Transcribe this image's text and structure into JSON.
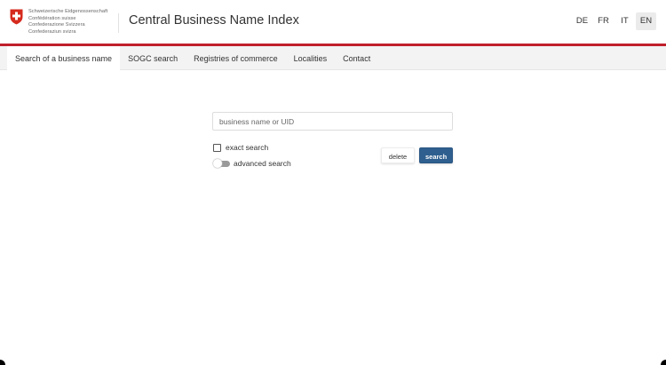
{
  "header": {
    "logo_lines": [
      "Schweizerische Eidgenossenschaft",
      "Confédération suisse",
      "Confederazione Svizzera",
      "Confederaziun svizra"
    ],
    "logo_icon": "swiss-cross-shield-icon",
    "title": "Central Business Name Index",
    "languages": [
      {
        "code": "DE",
        "active": false
      },
      {
        "code": "FR",
        "active": false
      },
      {
        "code": "IT",
        "active": false
      },
      {
        "code": "EN",
        "active": true
      }
    ]
  },
  "nav": {
    "items": [
      {
        "label": "Search of a business name",
        "active": true
      },
      {
        "label": "SOGC search",
        "active": false
      },
      {
        "label": "Registries of commerce",
        "active": false
      },
      {
        "label": "Localities",
        "active": false
      },
      {
        "label": "Contact",
        "active": false
      }
    ]
  },
  "search": {
    "input_value": "",
    "placeholder": "business name or UID",
    "exact_search_label": "exact search",
    "exact_search_checked": false,
    "advanced_search_label": "advanced search",
    "advanced_search_on": false,
    "delete_label": "delete",
    "search_label": "search"
  },
  "colors": {
    "brand_red": "#c0202c",
    "primary_button": "#2f5f8f",
    "nav_background": "#f3f3f3"
  }
}
